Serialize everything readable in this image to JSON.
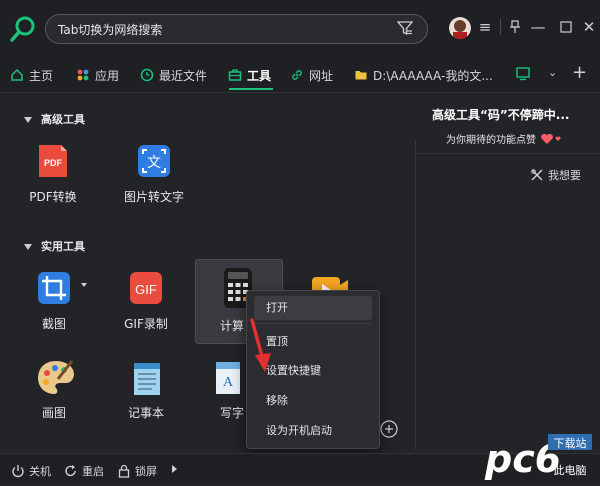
{
  "search": {
    "placeholder": "Tab切换为网络搜索"
  },
  "tabs": [
    {
      "label": "主页",
      "icon": "home-icon"
    },
    {
      "label": "应用",
      "icon": "apps-icon"
    },
    {
      "label": "最近文件",
      "icon": "clock-icon"
    },
    {
      "label": "工具",
      "icon": "toolbox-icon",
      "active": true
    },
    {
      "label": "网址",
      "icon": "link-icon"
    },
    {
      "label": "D:\\AAAAAA-我的文...",
      "icon": "folder-icon"
    }
  ],
  "sections": {
    "advanced": {
      "title": "高级工具"
    },
    "practical": {
      "title": "实用工具"
    }
  },
  "advanced_tools": [
    {
      "label": "PDF转换",
      "icon": "pdf-icon"
    },
    {
      "label": "图片转文字",
      "icon": "image-to-text-icon"
    }
  ],
  "practical_tools": [
    {
      "label": "截图",
      "icon": "crop-icon"
    },
    {
      "label": "GIF录制",
      "icon": "gif-icon"
    },
    {
      "label": "计算",
      "icon": "calculator-icon"
    },
    {
      "label": "画图",
      "icon": "palette-icon"
    },
    {
      "label": "记事本",
      "icon": "notepad-icon"
    },
    {
      "label": "写字",
      "icon": "text-editor-icon"
    }
  ],
  "right_panel": {
    "title": "高级工具“码”不停蹄中...",
    "subtitle": "为你期待的功能点赞",
    "want_button": "我想要"
  },
  "context_menu": {
    "items": [
      "打开",
      "置顶",
      "设置快捷键",
      "移除",
      "设为开机启动"
    ]
  },
  "bottom_bar": {
    "shutdown": "关机",
    "restart": "重启",
    "lock": "锁屏"
  },
  "watermark": {
    "brand": "pc6",
    "tag1": "下载站",
    "tag2": "此电脑"
  },
  "colors": {
    "accent": "#19c37d",
    "bg": "#232428",
    "menu_bg": "#2b2c30",
    "arrow": "#e03030"
  }
}
